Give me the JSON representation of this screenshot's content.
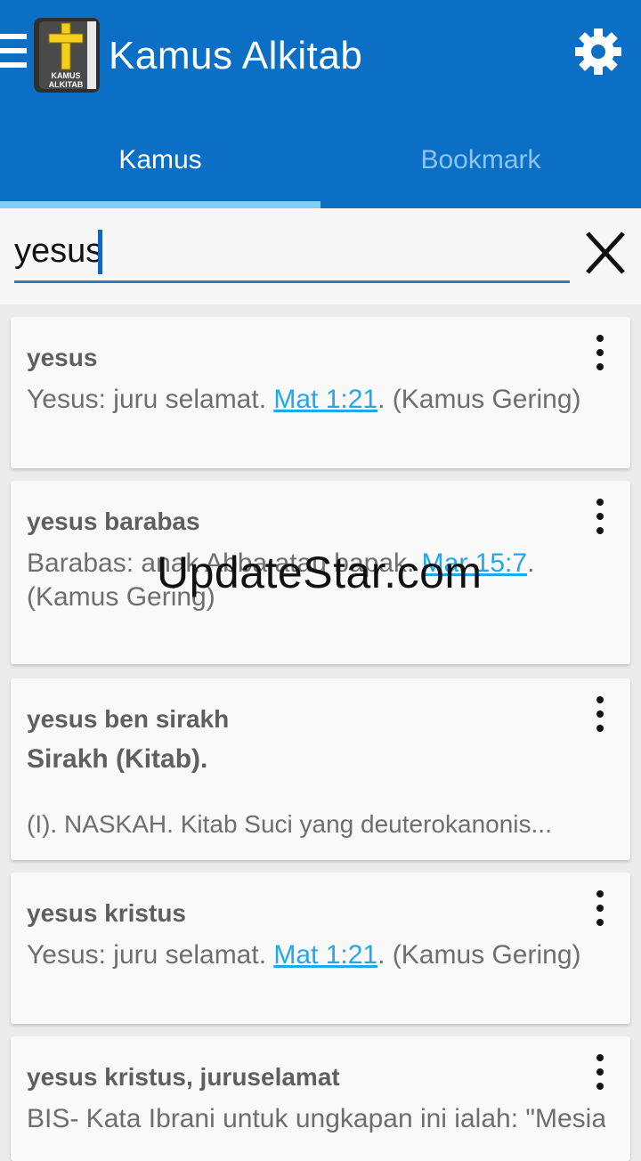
{
  "app": {
    "title": "Kamus Alkitab",
    "logo_text_1": "KAMUS",
    "logo_text_2": "ALKITAB",
    "accent_color": "#0b6fc6",
    "link_color": "#21a8e8"
  },
  "tabs": [
    {
      "label": "Kamus",
      "active": true
    },
    {
      "label": "Bookmark",
      "active": false
    }
  ],
  "search": {
    "value": "yesus"
  },
  "results": [
    {
      "term": "yesus",
      "pre": "Yesus: juru selamat. ",
      "link": "Mat 1:21",
      "post": ". (Kamus Gering)"
    },
    {
      "term": "yesus barabas",
      "pre": "Barabas: anak Abba atau bapak. ",
      "link": "Mar 15:7",
      "post": ". (Kamus Gering)"
    },
    {
      "term": "yesus ben sirakh",
      "subtitle": "Sirakh (Kitab).",
      "snippet": "(I). NASKAH. Kitab Suci yang deuterokanonis..."
    },
    {
      "term": "yesus kristus",
      "pre": "Yesus: juru selamat. ",
      "link": "Mat 1:21",
      "post": ". (Kamus Gering)"
    },
    {
      "term": "yesus kristus, juruselamat",
      "pre": "BIS- Kata Ibrani untuk ungkapan ini ialah: \"Mesias\".",
      "link": "",
      "post": ""
    }
  ],
  "watermark": "UpdateStar.com",
  "icons": {
    "menu": "menu-icon",
    "settings": "gear-icon",
    "clear": "close-icon",
    "overflow": "more-vert-icon"
  }
}
